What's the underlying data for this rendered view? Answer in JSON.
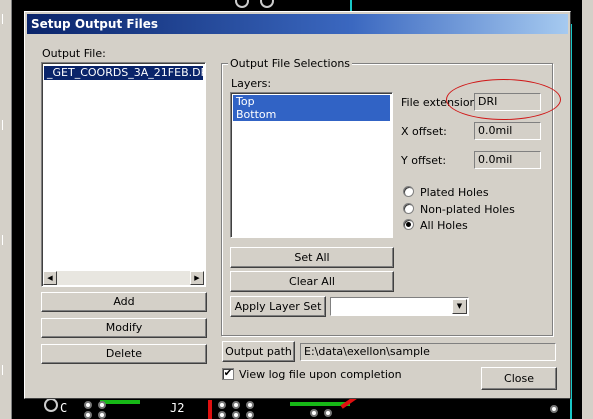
{
  "dialog": {
    "title": "Setup Output Files",
    "output_file_label": "Output File:",
    "output_files": [
      "_GET_COORDS_3A_21FEB.DRI"
    ],
    "buttons": {
      "add": "Add",
      "modify": "Modify",
      "delete": "Delete",
      "set_all": "Set All",
      "clear_all": "Clear All",
      "apply_layer_set": "Apply Layer Set",
      "output_path": "Output path",
      "close": "Close"
    },
    "selections": {
      "group_title": "Output File Selections",
      "layers_label": "Layers:",
      "layers": [
        "Top",
        "Bottom"
      ],
      "file_extension_label": "File extension:",
      "file_extension": "DRI",
      "x_offset_label": "X offset:",
      "x_offset": "0.0mil",
      "y_offset_label": "Y offset:",
      "y_offset": "0.0mil",
      "hole_options": [
        "Plated Holes",
        "Non-plated Holes",
        "All Holes"
      ],
      "selected_hole_option": "All Holes",
      "layer_set_value": ""
    },
    "output_path": "E:\\data\\exellon\\sample",
    "view_log_label": "View log file upon completion",
    "view_log_checked": true
  },
  "background": {
    "silk_texts": [
      "J2",
      "C"
    ]
  },
  "colors": {
    "title_start": "#0a246a",
    "title_end": "#a6caf0",
    "selection": "#0a246a",
    "annotation": "#d01818",
    "trace_green": "#17b817",
    "trace_red": "#e01010"
  }
}
